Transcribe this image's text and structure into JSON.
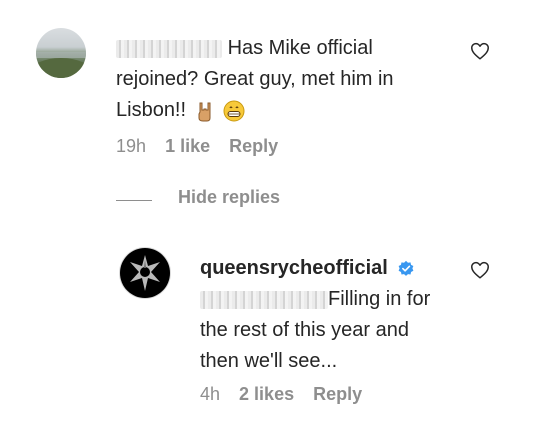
{
  "comment": {
    "text_line1": "Has Mike official",
    "text_line2": "rejoined? Great guy, met him in",
    "text_line3": "Lisbon!!",
    "emojis": [
      "hand-horns-emoji",
      "grinning-face-emoji"
    ],
    "time": "19h",
    "likes": "1 like",
    "reply_label": "Reply"
  },
  "thread": {
    "hide_replies_label": "Hide replies"
  },
  "reply": {
    "username": "queensrycheofficial",
    "text_line1": "Filling in for",
    "text_line2": "the rest of this year and",
    "text_line3": "then we'll see...",
    "time": "4h",
    "likes": "2 likes",
    "reply_label": "Reply"
  },
  "colors": {
    "text": "#262626",
    "secondary": "#8e8e8e",
    "verified": "#3897f0"
  },
  "icons": [
    "heart-icon",
    "verified-badge-icon"
  ]
}
